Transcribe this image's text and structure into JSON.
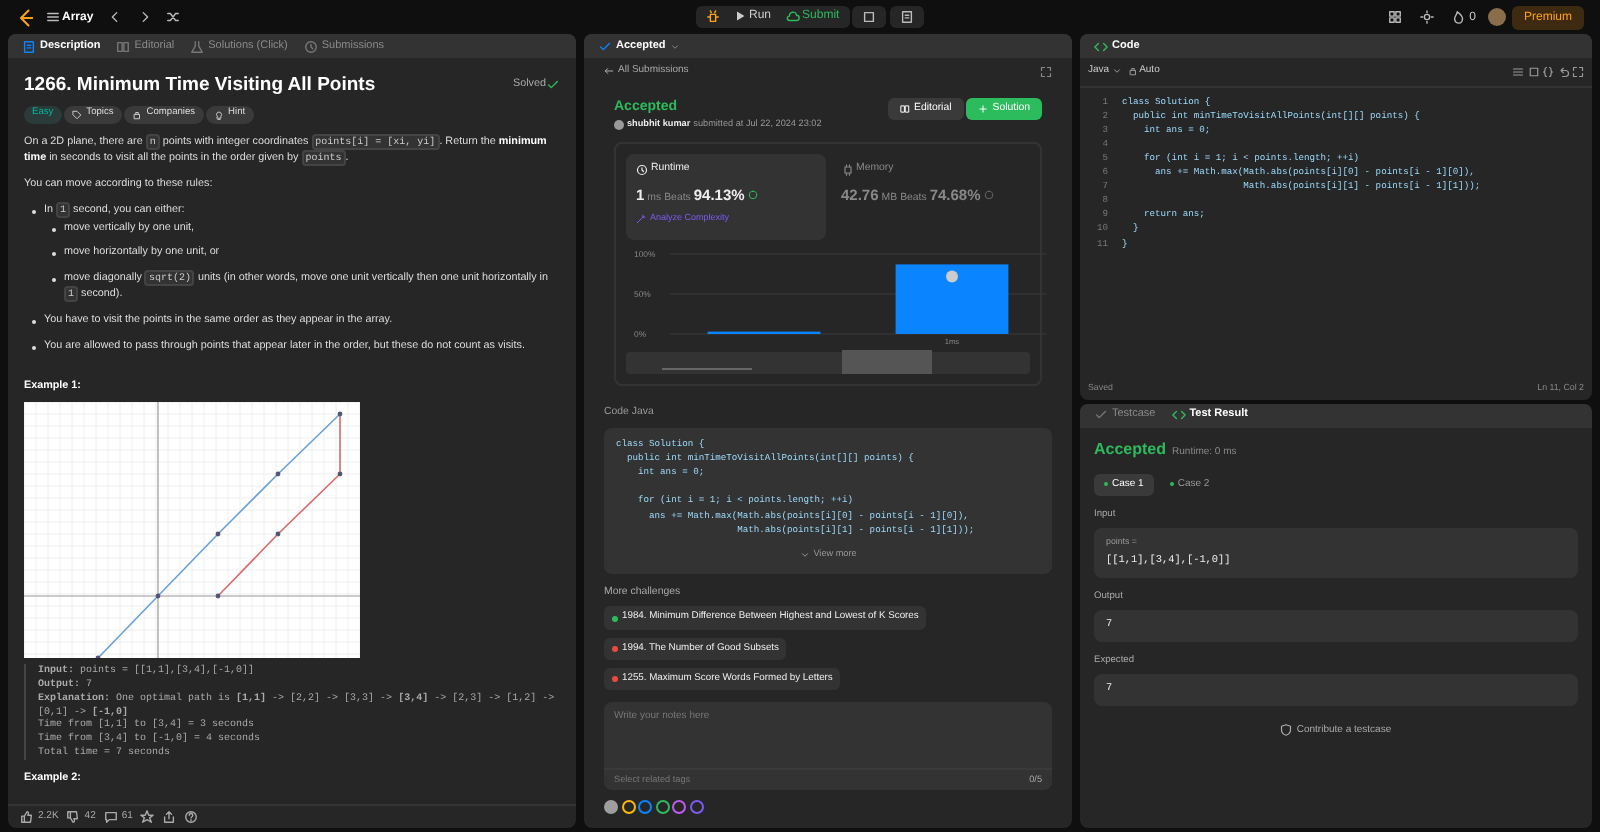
{
  "top_bar": {
    "problem_list": "Array",
    "run": "Run",
    "submit": "Submit",
    "streak": "0",
    "premium": "Premium"
  },
  "description_panel": {
    "tabs": [
      {
        "label": "Description",
        "selected": true
      },
      {
        "label": "Editorial",
        "selected": false
      },
      {
        "label": "Solutions",
        "note": "(Click)",
        "selected": false
      },
      {
        "label": "Submissions",
        "selected": false
      }
    ],
    "title": "1266. Minimum Time Visiting All Points",
    "status": "Solved",
    "tags": [
      {
        "label": "Easy",
        "kind": "difficulty"
      },
      {
        "label": "Topics",
        "kind": "topics"
      },
      {
        "label": "Companies",
        "kind": "companies"
      },
      {
        "label": "Hint",
        "kind": "hint"
      }
    ],
    "intro": [
      {
        "kind": "text",
        "text": "On a 2D plane, there are "
      },
      {
        "kind": "code",
        "text": "n"
      },
      {
        "kind": "text",
        "text": " points with integer coordinates "
      },
      {
        "kind": "code",
        "text": "points[i] = [xi, yi]"
      },
      {
        "kind": "text",
        "text": ". Return the "
      },
      {
        "kind": "bold",
        "text": "minimum time"
      },
      {
        "kind": "text",
        "text": " in seconds to visit all the points in the order given by "
      },
      {
        "kind": "code",
        "text": "points"
      },
      {
        "kind": "text",
        "text": "."
      }
    ],
    "rules_intro": "You can move according to these rules:",
    "rules": [
      {
        "segments": [
          {
            "kind": "text",
            "text": "In "
          },
          {
            "kind": "code",
            "text": "1"
          },
          {
            "kind": "text",
            "text": " second, you can either:"
          }
        ],
        "children": [
          {
            "segments": [
              {
                "kind": "text",
                "text": "move vertically by one unit,"
              }
            ]
          },
          {
            "segments": [
              {
                "kind": "text",
                "text": "move horizontally by one unit, or"
              }
            ]
          },
          {
            "segments": [
              {
                "kind": "text",
                "text": "move diagonally "
              },
              {
                "kind": "code",
                "text": "sqrt(2)"
              },
              {
                "kind": "text",
                "text": " units (in other words, move one unit vertically then one unit horizontally in "
              },
              {
                "kind": "code",
                "text": "1"
              },
              {
                "kind": "text",
                "text": " second)."
              }
            ]
          }
        ]
      },
      {
        "segments": [
          {
            "kind": "text",
            "text": "You have to visit the points in the same order as they appear in the array."
          }
        ]
      },
      {
        "segments": [
          {
            "kind": "text",
            "text": "You are allowed to pass through points that appear later in the order, but these do not count as visits."
          }
        ]
      }
    ],
    "example_title": "Example 1:",
    "example_lines": [
      "**Input:** points = [[1,1],[3,4],[-1,0]]",
      "**Output:** 7",
      "**Explanation:** One optimal path is **[1,1]** -> [2,2] -> [3,3] -> **[3,4]** -> [2,3] -> [1,2] -> [0,1] -> **[-1,0]**",
      "Time from [1,1] to [3,4] = 3 seconds",
      "Time from [3,4] to [-1,0] = 4 seconds",
      "Total time = 7 seconds"
    ],
    "next_example_title": "Example 2:",
    "footer": {
      "likes": "2.2K",
      "dislikes": "42",
      "comments": "61"
    }
  },
  "submission_panel": {
    "tab": "Accepted",
    "back_link": "All Submissions",
    "result": "Accepted",
    "user": "shubhit kumar",
    "submitted": "submitted at Jul 22, 2024 23:02",
    "buttons": [
      "Editorial",
      "Solution"
    ],
    "runtime": {
      "label": "Runtime",
      "value": "1",
      "unit": "ms",
      "beats_label": "Beats",
      "beats": "94.13%",
      "link": "Analyze Complexity",
      "selected": true
    },
    "memory": {
      "label": "Memory",
      "value": "42.76",
      "unit": "MB",
      "beats_label": "Beats",
      "beats": "74.68%",
      "selected": false
    },
    "chart_data": {
      "type": "bar",
      "values": [
        3,
        87
      ],
      "ylim": [
        0,
        100
      ],
      "yticks": [
        {
          "value": 0,
          "label": "0%"
        },
        {
          "value": 50,
          "label": "50%"
        },
        {
          "value": 100,
          "label": "100%"
        }
      ]
    },
    "bar_label": "1ms",
    "code_label": "Code",
    "code_language": "Java",
    "code": "class Solution {\n  public int minTimeToVisitAllPoints(int[][] points) {\n    int ans = 0;\n\n    for (int i = 1; i < points.length; ++i)\n      ans += Math.max(Math.abs(points[i][0] - points[i - 1][0]),\n                      Math.abs(points[i][1] - points[i - 1][1]));",
    "view_more": "View more",
    "more_title": "More challenges",
    "challenges": [
      {
        "title": "1984. Minimum Difference Between Highest and Lowest of K Scores",
        "color": "#2cbb5d"
      },
      {
        "title": "1994. The Number of Good Subsets",
        "color": "#ef4743"
      },
      {
        "title": "1255. Maximum Score Words Formed by Letters",
        "color": "#ef4743"
      }
    ],
    "notes": {
      "placeholder": "Write your notes here",
      "tags_placeholder": "Select related tags",
      "count": "0/5"
    },
    "note_colors": [
      {
        "color": "#9e9e9e",
        "selected": true
      },
      {
        "color": "#ffb800",
        "selected": false
      },
      {
        "color": "#0a84ff",
        "selected": false
      },
      {
        "color": "#2cbb5d",
        "selected": false
      },
      {
        "color": "#bf5af2",
        "selected": false
      },
      {
        "color": "#7d5af2",
        "selected": false
      }
    ]
  },
  "code_panel": {
    "title": "Code",
    "language": "Java",
    "mode": "Auto",
    "line_numbers": [
      "1",
      "2",
      "3",
      "4",
      "5",
      "6",
      "7",
      "8",
      "9",
      "10",
      "11"
    ],
    "code": "class Solution {\n  public int minTimeToVisitAllPoints(int[][] points) {\n    int ans = 0;\n\n    for (int i = 1; i < points.length; ++i)\n      ans += Math.max(Math.abs(points[i][0] - points[i - 1][0]),\n                      Math.abs(points[i][1] - points[i - 1][1]));\n\n    return ans;\n  }\n}",
    "saved": "Saved",
    "cursor": "Ln 11, Col 2"
  },
  "result_panel": {
    "tabs": [
      {
        "label": "Testcase",
        "selected": false
      },
      {
        "label": "Test Result",
        "selected": true
      }
    ],
    "result": "Accepted",
    "runtime": "Runtime: 0 ms",
    "cases": [
      {
        "label": "Case 1",
        "selected": true
      },
      {
        "label": "Case 2",
        "selected": false
      }
    ],
    "input_label": "Input",
    "input_name": "points =",
    "input_value": "[[1,1],[3,4],[-1,0]]",
    "output_label": "Output",
    "output_value": "7",
    "expected_label": "Expected",
    "expected_value": "7",
    "contribute": "Contribute a testcase"
  }
}
